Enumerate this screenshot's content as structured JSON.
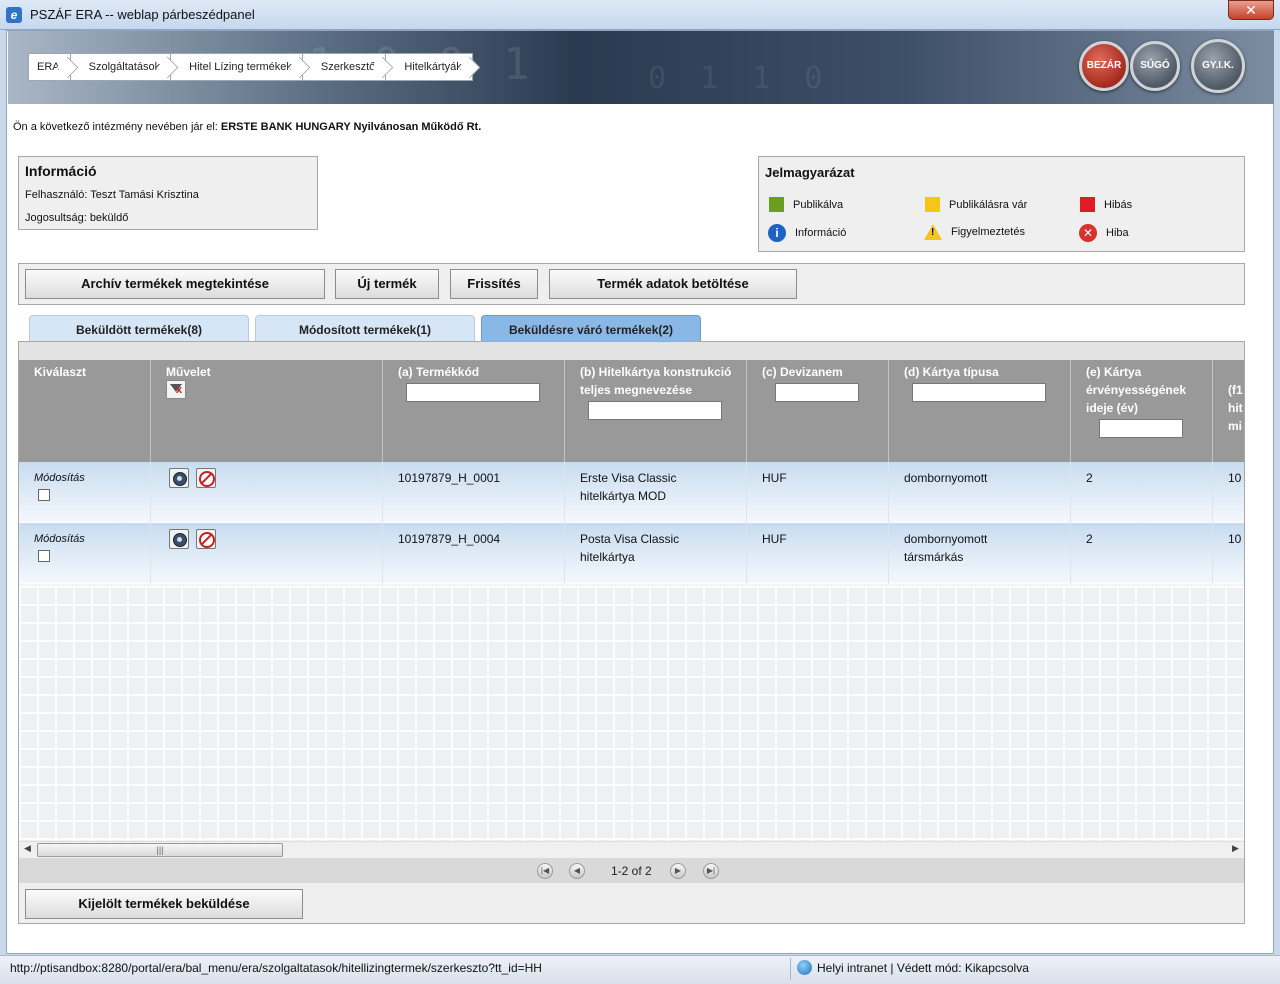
{
  "window": {
    "title": "PSZÁF ERA -- weblap párbeszédpanel",
    "close_label": "✕"
  },
  "breadcrumb": [
    "ERA",
    "Szolgáltatások",
    "Hitel Lízing termékek",
    "Szerkesztő",
    "Hitelkártyák"
  ],
  "header_buttons": {
    "close": "BEZÁR",
    "help": "SÚGÓ",
    "faq": "GY.I.K."
  },
  "institution": {
    "prefix": "Ön a következő intézmény nevében jár el:",
    "name": "ERSTE BANK HUNGARY Nyilvánosan Működő Rt."
  },
  "info": {
    "title": "Információ",
    "user": "Felhasználó: Teszt Tamási Krisztina",
    "role": "Jogosultság: beküldő"
  },
  "legend": {
    "title": "Jelmagyarázat",
    "items": [
      {
        "label": "Publikálva",
        "color": "#6a9e1f"
      },
      {
        "label": "Publikálásra vár",
        "color": "#f5c518"
      },
      {
        "label": "Hibás",
        "color": "#e01b22"
      },
      {
        "label": "Információ",
        "icon": "info-icon"
      },
      {
        "label": "Figyelmeztetés",
        "icon": "warning-icon"
      },
      {
        "label": "Hiba",
        "icon": "error-icon"
      }
    ]
  },
  "toolbar": {
    "archive": "Archív termékek megtekintése",
    "new": "Új termék",
    "refresh": "Frissítés",
    "load": "Termék adatok betöltése"
  },
  "tabs": [
    {
      "label": "Beküldött termékek(8)",
      "active": false
    },
    {
      "label": "Módosított termékek(1)",
      "active": false
    },
    {
      "label": "Beküldésre váró termékek(2)",
      "active": true
    }
  ],
  "table": {
    "columns": [
      "Kiválaszt",
      "Művelet",
      "(a) Termékkód",
      "(b) Hitelkártya konstrukció teljes megnevezése",
      "(c) Devizanem",
      "(d) Kártya típusa",
      "(e) Kártya érvényességének ideje (év)",
      "(f1 hit mi"
    ],
    "rows": [
      {
        "select_label": "Módosítás",
        "code": "10197879_H_0001",
        "name": "Erste Visa Classic hitelkártya MOD",
        "currency": "HUF",
        "type": "dombornyomott",
        "validity": "2",
        "f1": "10"
      },
      {
        "select_label": "Módosítás",
        "code": "10197879_H_0004",
        "name": "Posta Visa Classic hitelkártya",
        "currency": "HUF",
        "type": "dombornyomott társmárkás",
        "validity": "2",
        "f1": "10"
      }
    ]
  },
  "pager": {
    "text": "1-2 of 2"
  },
  "send_button": "Kijelölt termékek beküldése",
  "statusbar": {
    "url": "http://ptisandbox:8280/portal/era/bal_menu/era/szolgaltatasok/hitellizingtermek/szerkeszto?tt_id=HH",
    "zone": "Helyi intranet | Védett mód: Kikapcsolva"
  }
}
